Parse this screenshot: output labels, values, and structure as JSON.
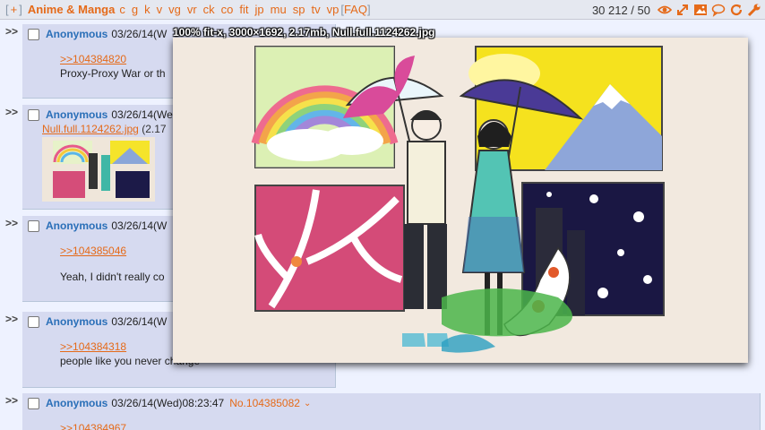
{
  "nav": {
    "open": "[",
    "plus": "+",
    "close": "]",
    "board_title": "Anime & Manga",
    "boards": [
      "c",
      "g",
      "k",
      "v",
      "vg",
      "vr",
      "ck",
      "co",
      "fit",
      "jp",
      "mu",
      "sp",
      "tv",
      "vp"
    ],
    "faq_open": "[",
    "faq": "FAQ",
    "faq_close": "]",
    "counter": "30 212 / 50",
    "icons": [
      "eye-icon",
      "expand-icon",
      "image-icon",
      "chat-bubble-icon",
      "refresh-icon",
      "wrench-icon"
    ]
  },
  "colors": {
    "accent": "#e56a19",
    "name": "#2a6fb8",
    "post_bg": "#d6daf0",
    "page_bg": "#eef2ff"
  },
  "arrows": ">>",
  "posts": [
    {
      "name": "Anonymous",
      "date": "03/26/14(W",
      "quote": ">>104384820",
      "text": "Proxy-Proxy War or th"
    },
    {
      "name": "Anonymous",
      "date": "03/26/14(We",
      "file_link": "Null.full.1124262.jpg",
      "file_meta": "(2.17"
    },
    {
      "name": "Anonymous",
      "date": "03/26/14(W",
      "quote": ">>104385046",
      "text": "Yeah, I didn't really co"
    },
    {
      "name": "Anonymous",
      "date": "03/26/14(W",
      "quote": ">>104384318",
      "text": "people like you never change"
    },
    {
      "name": "Anonymous",
      "date": "03/26/14(Wed)08:23:47",
      "postno": "No.104385082",
      "caret": "⌄",
      "quote": ">>104384967"
    }
  ],
  "preview": {
    "label": "100% fit-x, 3000×1692, 2.17mb, Null.full.1124262.jpg"
  }
}
